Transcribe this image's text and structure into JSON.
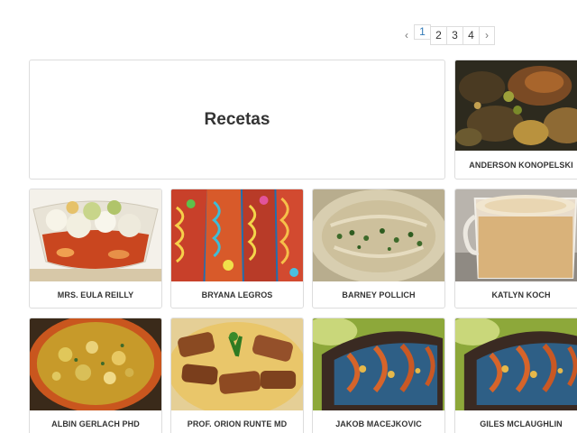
{
  "pagination": {
    "prev": "‹",
    "pages": [
      "1",
      "2",
      "3",
      "4"
    ],
    "next": "›",
    "current": "1"
  },
  "hero": {
    "title": "Recetas"
  },
  "cards": [
    {
      "name": "ANDERSON KONOPELSKI",
      "photo": "roast-meat-photo"
    },
    {
      "name": "MRS. EULA REILLY",
      "photo": "ceviche-glass-photo"
    },
    {
      "name": "BRYANA LEGROS",
      "photo": "decorated-bread-photo"
    },
    {
      "name": "BARNEY POLLICH",
      "photo": "hummus-bowl-photo"
    },
    {
      "name": "KATLYN KOCH",
      "photo": "coffee-mug-photo"
    },
    {
      "name": "ALBIN GERLACH PHD",
      "photo": "soup-bowl-photo"
    },
    {
      "name": "PROF. ORION RUNTE MD",
      "photo": "meat-stew-photo"
    },
    {
      "name": "JAKOB MACEJKOVIC",
      "photo": "grilled-fish-photo"
    },
    {
      "name": "GILES MCLAUGHLIN",
      "photo": "grilled-fish-photo"
    }
  ]
}
